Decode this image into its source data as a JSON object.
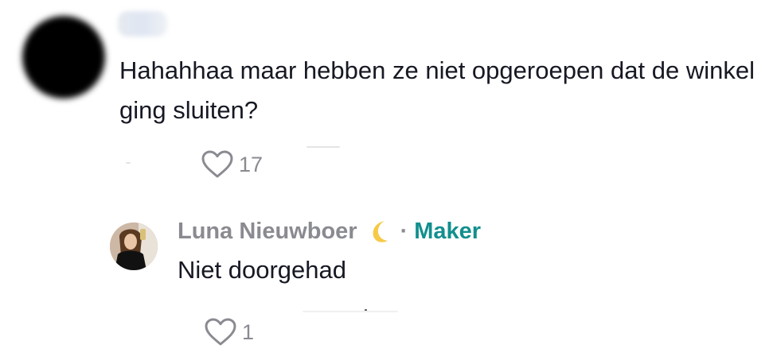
{
  "comment": {
    "text": "Hahahhaa maar hebben ze niet opgeroepen dat de winkel ging sluiten?",
    "likes": "17",
    "like_icon": "heart-outline-icon"
  },
  "reply": {
    "author": "Luna Nieuwboer",
    "author_emoji_icon": "crescent-moon-icon",
    "separator": "·",
    "badge": "Maker",
    "text": "Niet doorgehad",
    "likes": "1",
    "like_icon": "heart-outline-icon"
  },
  "colors": {
    "text": "#161823",
    "muted": "#8a8b91",
    "maker": "#128f8e",
    "moon": "#f6c948"
  }
}
